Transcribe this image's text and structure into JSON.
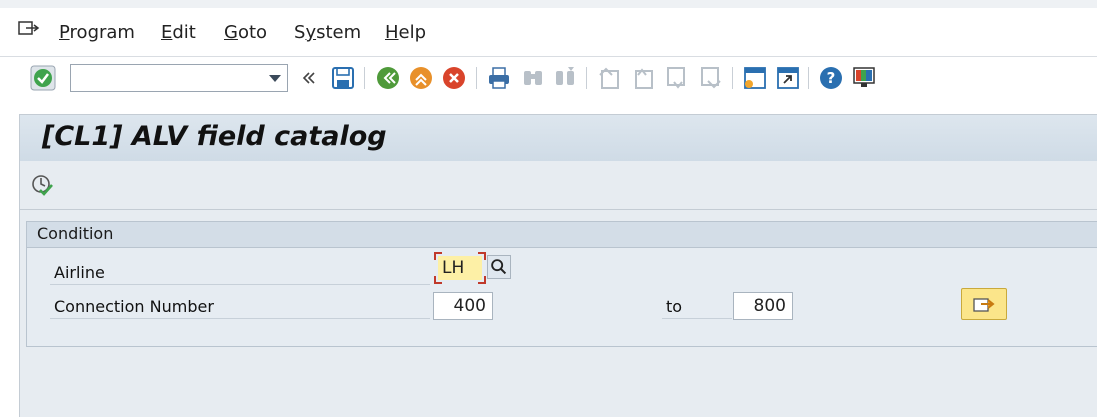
{
  "menu": {
    "items": [
      {
        "label": "Program",
        "hotkey": "P",
        "rest": "rogram"
      },
      {
        "label": "Edit",
        "hotkey": "E",
        "rest": "dit"
      },
      {
        "label": "Goto",
        "hotkey": "G",
        "rest": "oto"
      },
      {
        "label": "System",
        "hotkey": "y",
        "pre": "S",
        "rest": "stem"
      },
      {
        "label": "Help",
        "hotkey": "H",
        "rest": "elp"
      }
    ]
  },
  "toolbar": {
    "command_field_value": "",
    "icons": [
      "enter-icon",
      "collapse-icon",
      "save-icon",
      "back-icon",
      "exit-icon",
      "cancel-icon",
      "print-icon",
      "find-icon",
      "find-next-icon",
      "first-page-icon",
      "previous-page-icon",
      "next-page-icon",
      "last-page-icon",
      "create-session-icon",
      "shortcut-icon",
      "help-icon",
      "layout-icon"
    ]
  },
  "screen": {
    "title": "[CL1] ALV field catalog"
  },
  "condition": {
    "group_title": "Condition",
    "airline_label": "Airline",
    "airline_value": "LH",
    "connection_label": "Connection Number",
    "connection_from": "400",
    "to_label": "to",
    "connection_to": "800"
  },
  "colors": {
    "accent_yellow": "#fbe58a",
    "focus_field": "#fdf0a6",
    "panel": "#e7ecf1"
  }
}
